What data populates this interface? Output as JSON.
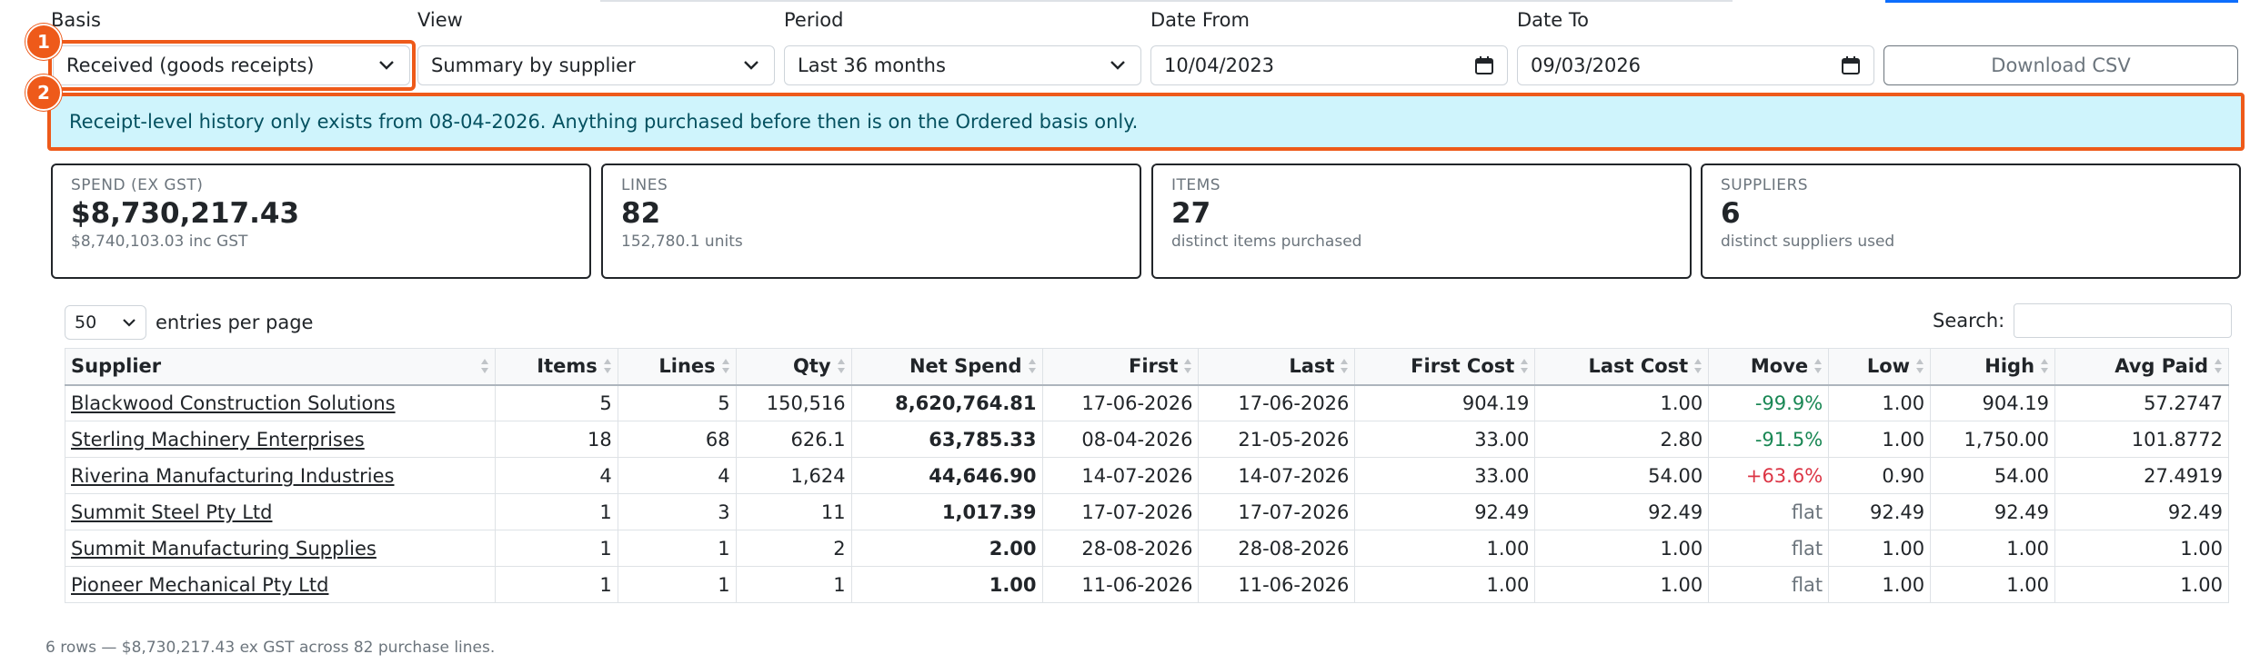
{
  "filters": {
    "basis": {
      "label": "Basis",
      "value": "Received (goods receipts)"
    },
    "view": {
      "label": "View",
      "value": "Summary by supplier"
    },
    "period": {
      "label": "Period",
      "value": "Last 36 months"
    },
    "date_from": {
      "label": "Date From",
      "value": "10/04/2023"
    },
    "date_to": {
      "label": "Date To",
      "value": "09/03/2026"
    },
    "download_label": "Download CSV"
  },
  "annotations": [
    "1",
    "2"
  ],
  "alert": "Receipt-level history only exists from 08-04-2026. Anything purchased before then is on the Ordered basis only.",
  "cards": [
    {
      "key": "SPEND (EX GST)",
      "value": "$8,730,217.43",
      "sub": "$8,740,103.03 inc GST"
    },
    {
      "key": "LINES",
      "value": "82",
      "sub": "152,780.1 units"
    },
    {
      "key": "ITEMS",
      "value": "27",
      "sub": "distinct items purchased"
    },
    {
      "key": "SUPPLIERS",
      "value": "6",
      "sub": "distinct suppliers used"
    }
  ],
  "table_controls": {
    "page_length": "50",
    "entries_label": "entries per page",
    "search_label": "Search:"
  },
  "table": {
    "columns": [
      "Supplier",
      "Items",
      "Lines",
      "Qty",
      "Net Spend",
      "First",
      "Last",
      "First Cost",
      "Last Cost",
      "Move",
      "Low",
      "High",
      "Avg Paid"
    ],
    "rows": [
      {
        "supplier": "Blackwood Construction Solutions",
        "items": "5",
        "lines": "5",
        "qty": "150,516",
        "net": "8,620,764.81",
        "first": "17-06-2026",
        "last": "17-06-2026",
        "first_cost": "904.19",
        "last_cost": "1.00",
        "move": "-99.9%",
        "move_dir": "down",
        "low": "1.00",
        "high": "904.19",
        "avg": "57.2747"
      },
      {
        "supplier": "Sterling Machinery Enterprises",
        "items": "18",
        "lines": "68",
        "qty": "626.1",
        "net": "63,785.33",
        "first": "08-04-2026",
        "last": "21-05-2026",
        "first_cost": "33.00",
        "last_cost": "2.80",
        "move": "-91.5%",
        "move_dir": "down",
        "low": "1.00",
        "high": "1,750.00",
        "avg": "101.8772"
      },
      {
        "supplier": "Riverina Manufacturing Industries",
        "items": "4",
        "lines": "4",
        "qty": "1,624",
        "net": "44,646.90",
        "first": "14-07-2026",
        "last": "14-07-2026",
        "first_cost": "33.00",
        "last_cost": "54.00",
        "move": "+63.6%",
        "move_dir": "up",
        "low": "0.90",
        "high": "54.00",
        "avg": "27.4919"
      },
      {
        "supplier": "Summit Steel Pty Ltd",
        "items": "1",
        "lines": "3",
        "qty": "11",
        "net": "1,017.39",
        "first": "17-07-2026",
        "last": "17-07-2026",
        "first_cost": "92.49",
        "last_cost": "92.49",
        "move": "flat",
        "move_dir": "flat",
        "low": "92.49",
        "high": "92.49",
        "avg": "92.49"
      },
      {
        "supplier": "Summit Manufacturing Supplies",
        "items": "1",
        "lines": "1",
        "qty": "2",
        "net": "2.00",
        "first": "28-08-2026",
        "last": "28-08-2026",
        "first_cost": "1.00",
        "last_cost": "1.00",
        "move": "flat",
        "move_dir": "flat",
        "low": "1.00",
        "high": "1.00",
        "avg": "1.00"
      },
      {
        "supplier": "Pioneer Mechanical Pty Ltd",
        "items": "1",
        "lines": "1",
        "qty": "1",
        "net": "1.00",
        "first": "11-06-2026",
        "last": "11-06-2026",
        "first_cost": "1.00",
        "last_cost": "1.00",
        "move": "flat",
        "move_dir": "flat",
        "low": "1.00",
        "high": "1.00",
        "avg": "1.00"
      }
    ]
  },
  "footer": "6 rows — $8,730,217.43 ex GST across 82 purchase lines.",
  "colors": {
    "accent": "#ee5a1a",
    "alert_bg": "#cff4fc",
    "alert_text": "#055160",
    "move_down": "#198754",
    "move_up": "#dc3545"
  }
}
